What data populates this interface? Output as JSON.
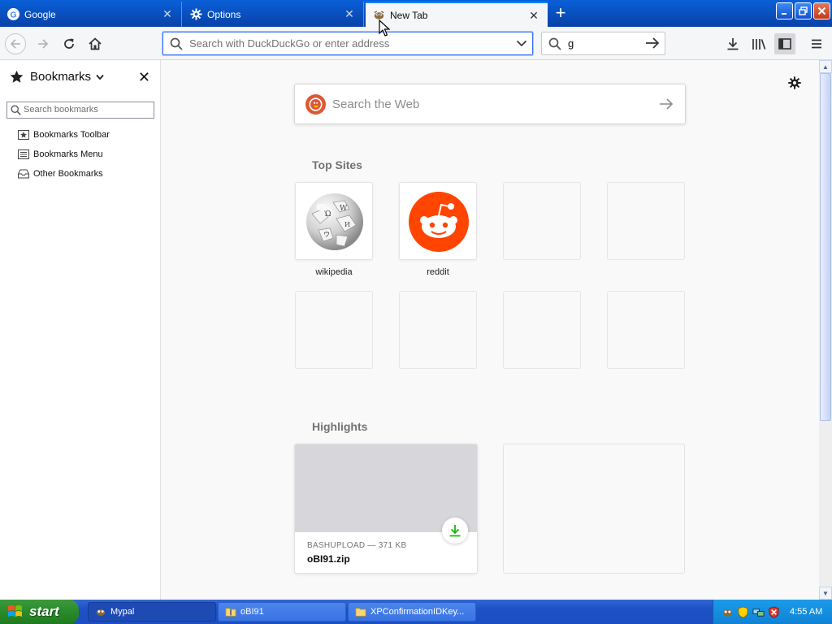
{
  "browser": {
    "tabs": [
      {
        "label": "Google",
        "icon": "google-icon",
        "active": false
      },
      {
        "label": "Options",
        "icon": "gear-icon",
        "active": false
      },
      {
        "label": "New Tab",
        "icon": "mypal-icon",
        "active": true
      }
    ],
    "urlbar": {
      "placeholder": "Search with DuckDuckGo or enter address",
      "value": ""
    },
    "searchbar": {
      "value": "g"
    }
  },
  "sidebar": {
    "title": "Bookmarks",
    "search_placeholder": "Search bookmarks",
    "items": [
      {
        "label": "Bookmarks Toolbar",
        "icon": "bookmarks-toolbar-icon"
      },
      {
        "label": "Bookmarks Menu",
        "icon": "bookmarks-menu-icon"
      },
      {
        "label": "Other Bookmarks",
        "icon": "other-bookmarks-icon"
      }
    ]
  },
  "newtab": {
    "search_placeholder": "Search the Web",
    "top_sites_title": "Top Sites",
    "top_sites": [
      {
        "label": "wikipedia",
        "icon": "wikipedia-globe-icon"
      },
      {
        "label": "reddit",
        "icon": "reddit-icon"
      }
    ],
    "highlights_title": "Highlights",
    "highlight": {
      "source": "BASHUPLOAD",
      "size": "371 KB",
      "meta": "BASHUPLOAD — 371 KB",
      "name": "oBI91.zip"
    }
  },
  "taskbar": {
    "start_label": "start",
    "tasks": [
      {
        "label": "Mypal",
        "pressed": true
      },
      {
        "label": "oBI91",
        "pressed": false
      },
      {
        "label": "XPConfirmationIDKey...",
        "pressed": false
      }
    ],
    "clock": "4:55 AM"
  },
  "colors": {
    "accent": "#0a84ff",
    "reddit": "#ff4500",
    "duckduckgo": "#de5833",
    "download_green": "#12bc00",
    "xp_blue": "#0a5fd8"
  }
}
